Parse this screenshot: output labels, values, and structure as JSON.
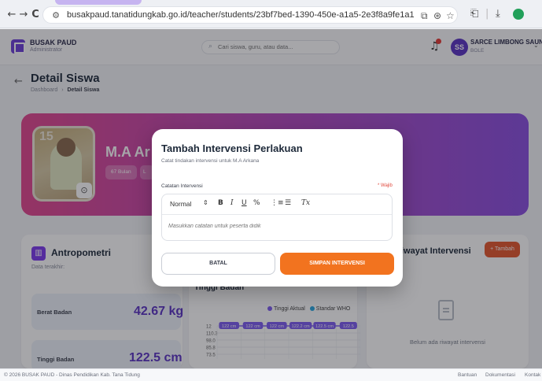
{
  "browser": {
    "url": "busakpaud.tanatidungkab.go.id/teacher/students/23bf7bed-1390-450e-a1a5-2e3f8a9fe1a1",
    "nav_back": "←",
    "nav_forward": "→",
    "nav_reload": "C",
    "site_info_icon": "⚙",
    "url_icons": [
      "⧉",
      "⊛",
      "☆"
    ],
    "toolbar_icons": [
      "⎗",
      "|",
      "⤓"
    ]
  },
  "header": {
    "brand_name": "BUSAK PAUD",
    "brand_role": "Administrator",
    "search_placeholder": "Cari siswa, guru, atau data...",
    "avatar_initials": "SS",
    "user_name": "SARCE LIMBONG SAUNG",
    "user_sub": "BOLE"
  },
  "page": {
    "title": "Detail Siswa",
    "breadcrumb_root": "Dashboard",
    "breadcrumb_sep": "›",
    "breadcrumb_current": "Detail Siswa"
  },
  "profile": {
    "name": "M.A Ar",
    "photo_number": "15",
    "chips": [
      "67 Bulan",
      "L"
    ]
  },
  "antropometri": {
    "title": "Antropometri",
    "subtitle": "Data terakhir:",
    "metrics": [
      {
        "label": "Berat Badan",
        "value": "42.67 kg"
      },
      {
        "label": "Tinggi Badan",
        "value": "122.5 cm"
      }
    ]
  },
  "chart_card": {
    "title": "Tinggi Badan"
  },
  "chart_data": {
    "type": "line",
    "title": "Tinggi Badan",
    "series": [
      {
        "name": "Tinggi Aktual",
        "color": "#7c5cf0"
      },
      {
        "name": "Standar WHO",
        "color": "#2aa8e0"
      }
    ],
    "data_labels": [
      "122 cm",
      "122 cm",
      "122 cm",
      "122.2 cm",
      "122.5 cm",
      "122.5"
    ],
    "y_ticks": [
      "12",
      "110.3",
      "98.0",
      "85.8",
      "73.5"
    ],
    "grid": true
  },
  "riwayat": {
    "title": "iwayat Intervensi",
    "add_button": "+ Tambah",
    "empty_text": "Belum ada riwayat intervensi"
  },
  "modal": {
    "title": "Tambah Intervensi Perlakuan",
    "subtitle": "Catat tindakan intervensi untuk M.A Arkana",
    "field_label": "Catatan Intervensi",
    "required": "* Wajib",
    "toolbar": {
      "format": "Normal",
      "format_arrow": "⇕",
      "bold": "B",
      "italic": "I",
      "underline": "U",
      "link": "%",
      "ordered_list": "⋮≡",
      "bullet_list": "☰",
      "clear": "Tx"
    },
    "placeholder": "Masukkan catatan untuk peserta didik",
    "cancel_label": "BATAL",
    "save_label": "SIMPAN INTERVENSI"
  },
  "footer": {
    "copyright": "© 2026 BUSAK PAUD - Dinas Pendidikan Kab. Tana Tidung",
    "links": [
      "Bantuan",
      "Dokumentasi",
      "Kontak"
    ]
  }
}
